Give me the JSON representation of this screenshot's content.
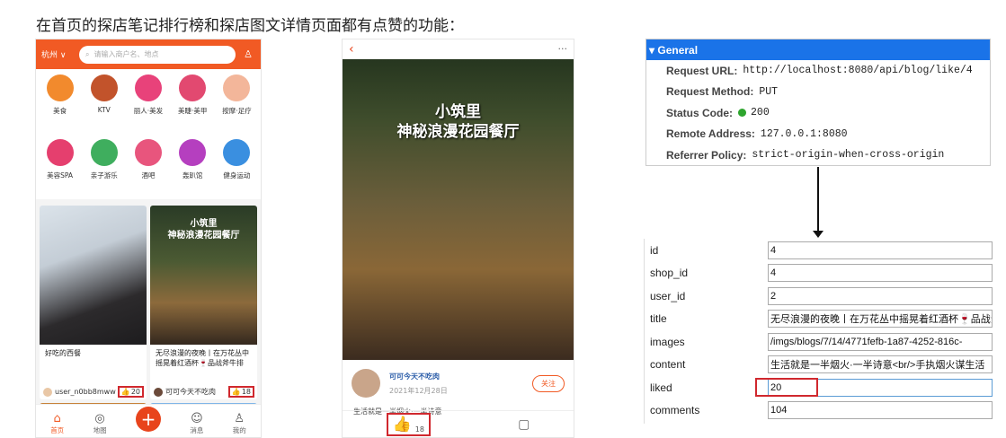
{
  "caption": "在首页的探店笔记排行榜和探店图文详情页面都有点赞的功能：",
  "colors": {
    "accent": "#f15a24",
    "highlight": "#d0282e",
    "devtools_blue": "#1a73e8"
  },
  "phone1": {
    "city": "杭州 ∨",
    "search_placeholder": "请输入商户名、地点",
    "categories": [
      {
        "label": "美食",
        "color": "#f28a2d"
      },
      {
        "label": "KTV",
        "color": "#c2532b"
      },
      {
        "label": "丽人·美发",
        "color": "#e8427a"
      },
      {
        "label": "美睫·美甲",
        "color": "#e24970"
      },
      {
        "label": "按摩·足疗",
        "color": "#f3b69a"
      },
      {
        "label": "美容SPA",
        "color": "#e53f6e"
      },
      {
        "label": "亲子游乐",
        "color": "#3fae5e"
      },
      {
        "label": "酒吧",
        "color": "#e8557d"
      },
      {
        "label": "轰趴馆",
        "color": "#b53fbf"
      },
      {
        "label": "健身运动",
        "color": "#3a8fe0"
      }
    ],
    "cards": [
      {
        "title": "好吃的西餐",
        "user": "user_n0bb8mww",
        "likes": "20"
      },
      {
        "title": "无尽浪漫的夜晚丨在万花丛中摇晃着红酒杯🍷品战斧牛排",
        "user": "可可今天不吃肉",
        "likes": "18"
      }
    ],
    "tabs": [
      {
        "label": "首页",
        "icon": "⌂",
        "icon_name": "home-icon"
      },
      {
        "label": "地图",
        "icon": "◎",
        "icon_name": "map-icon"
      },
      {
        "label": "",
        "icon": "+",
        "icon_name": "plus-icon"
      },
      {
        "label": "消息",
        "icon": "☺",
        "icon_name": "message-icon"
      },
      {
        "label": "我的",
        "icon": "♙",
        "icon_name": "profile-icon"
      }
    ]
  },
  "phone2": {
    "poster_title_line1": "小筑里",
    "poster_title_line2": "神秘浪漫花园餐厅",
    "author": "可可今天不吃肉",
    "date": "2021年12月28日",
    "follow_label": "关注",
    "snippet": "生活就是一半烟火·一半诗意",
    "likes": "18"
  },
  "devtools": {
    "header": "▾ General",
    "rows": [
      {
        "key": "Request URL:",
        "value": "http://localhost:8080/api/blog/like/4"
      },
      {
        "key": "Request Method:",
        "value": "PUT"
      },
      {
        "key": "Status Code:",
        "value": "200"
      },
      {
        "key": "Remote Address:",
        "value": "127.0.0.1:8080"
      },
      {
        "key": "Referrer Policy:",
        "value": "strict-origin-when-cross-origin"
      }
    ]
  },
  "record": {
    "fields": [
      {
        "key": "id",
        "value": "4"
      },
      {
        "key": "shop_id",
        "value": "4"
      },
      {
        "key": "user_id",
        "value": "2"
      },
      {
        "key": "title",
        "value": "无尽浪漫的夜晚丨在万花丛中摇晃着红酒杯🍷品战斧"
      },
      {
        "key": "images",
        "value": "/imgs/blogs/7/14/4771fefb-1a87-4252-816c-"
      },
      {
        "key": "content",
        "value": "生活就是一半烟火·一半诗意<br/>手执烟火谋生活"
      },
      {
        "key": "liked",
        "value": "20"
      },
      {
        "key": "comments",
        "value": "104"
      }
    ]
  }
}
